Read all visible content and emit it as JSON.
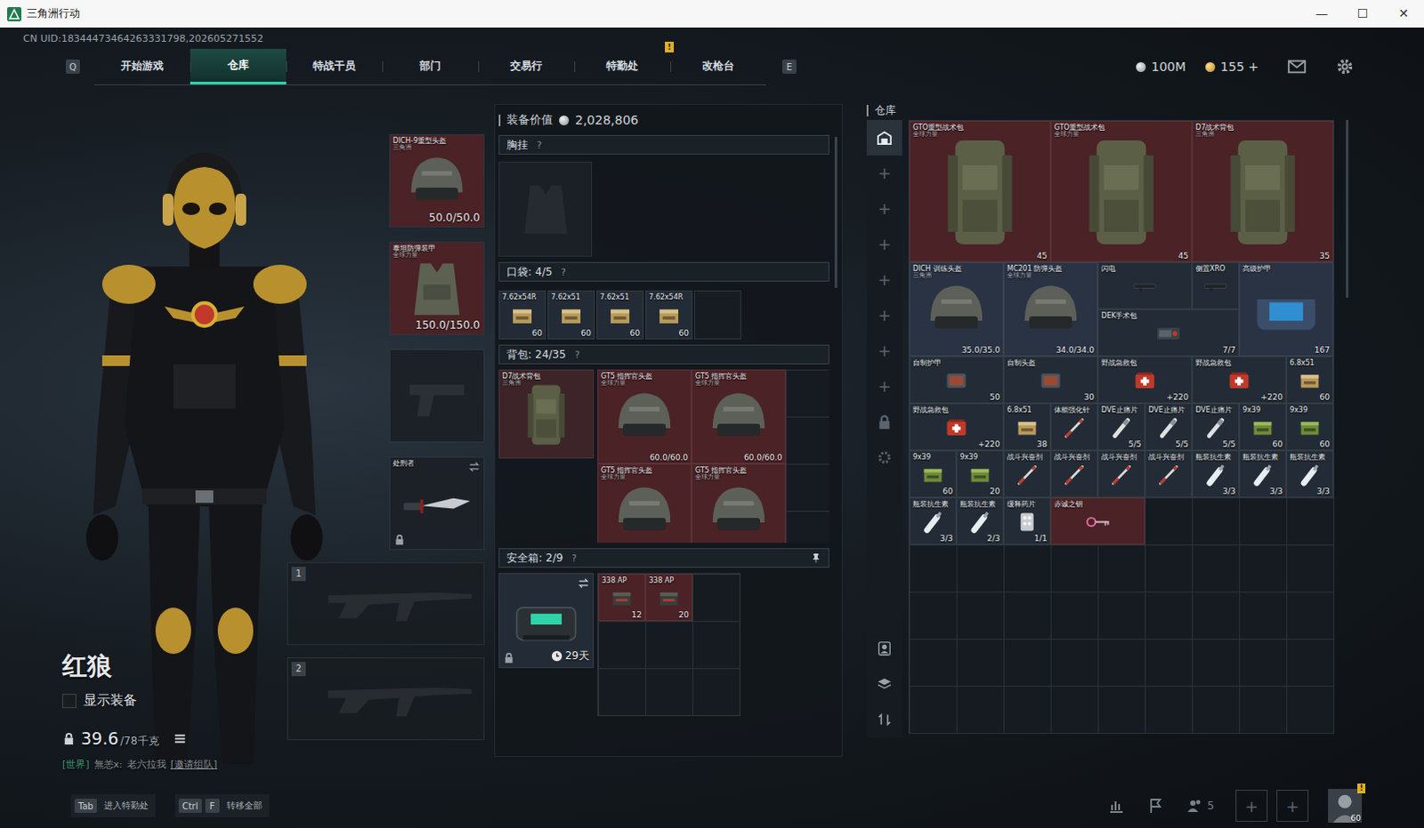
{
  "window": {
    "title": "三角洲行动",
    "controls": [
      "—",
      "☐",
      "✕"
    ]
  },
  "uid": "CN UID:18344473464263331798,202605271552",
  "nav": {
    "left_key": "Q",
    "right_key": "E",
    "tabs": [
      {
        "label": "开始游戏",
        "selected": false,
        "badge": ""
      },
      {
        "label": "仓库",
        "selected": true,
        "badge": ""
      },
      {
        "label": "特战干员",
        "selected": false,
        "badge": ""
      },
      {
        "label": "部门",
        "selected": false,
        "badge": ""
      },
      {
        "label": "交易行",
        "selected": false,
        "badge": ""
      },
      {
        "label": "特勤处",
        "selected": false,
        "badge": "!"
      },
      {
        "label": "改枪台",
        "selected": false,
        "badge": ""
      }
    ],
    "currency": [
      {
        "value": "100M",
        "kind": "silver"
      },
      {
        "value": "155 +",
        "kind": "gold"
      }
    ]
  },
  "character": {
    "name": "红狼",
    "show_gear": {
      "label": "显示装备",
      "checked": false
    },
    "weight": "39.6",
    "weight_max": "/78千克",
    "chat": {
      "channel": "[世界]",
      "user": "無恙x:",
      "message": "老六拉我",
      "action": "[邀请组队]"
    }
  },
  "equipment": [
    {
      "name": "DICH-9重型头盔",
      "sub": "三角洲",
      "value": "50.0/50.0",
      "kind": "helmet",
      "color": "#4b2226",
      "locked": false,
      "swappable": false
    },
    {
      "name": "泰坦防弹装甲",
      "sub": "全球力量",
      "value": "150.0/150.0",
      "kind": "armor",
      "color": "#4b2226",
      "locked": false,
      "swappable": false
    },
    {
      "name": "",
      "sub": "",
      "value": "",
      "kind": "pistol",
      "color": "#1b2127",
      "locked": false,
      "swappable": false
    },
    {
      "name": "处刑者",
      "sub": "",
      "value": "",
      "kind": "knife",
      "color": "#1b2127",
      "locked": true,
      "swappable": true
    }
  ],
  "weapon_slots": [
    {
      "label": "1"
    },
    {
      "label": "2"
    }
  ],
  "loadout": {
    "value_label": "装备价值",
    "value": "2,028,806",
    "chest": {
      "title": "胸挂",
      "help": "?"
    },
    "pockets": {
      "title": "口袋:",
      "count": "4/5",
      "help": "?",
      "empty_slots": 1,
      "items": [
        {
          "name": "7.62x54R",
          "value": "60",
          "kind": "ammo"
        },
        {
          "name": "7.62x51",
          "value": "60",
          "kind": "ammo"
        },
        {
          "name": "7.62x51",
          "value": "60",
          "kind": "ammo"
        },
        {
          "name": "7.62x54R",
          "value": "60",
          "kind": "ammo"
        }
      ]
    },
    "backpack": {
      "title": "背包:",
      "count": "24/35",
      "help": "?",
      "bag": {
        "name": "D7战术背包",
        "sub": "三角洲",
        "kind": "bag",
        "color": "#3d2428"
      },
      "items": [
        {
          "name": "GT5 指挥官头盔",
          "sub": "全球力量",
          "value": "60.0/60.0",
          "kind": "helmet",
          "color": "#4b2226",
          "size": [
            2,
            2
          ]
        },
        {
          "name": "GT5 指挥官头盔",
          "sub": "全球力量",
          "value": "60.0/60.0",
          "kind": "helmet",
          "color": "#4b2226",
          "size": [
            2,
            2
          ]
        },
        {
          "name": "GT5 指挥官头盔",
          "sub": "全球力量",
          "value": "",
          "kind": "helmet",
          "color": "#4b2226",
          "size": [
            2,
            2
          ]
        },
        {
          "name": "GT5 指挥官头盔",
          "sub": "全球力量",
          "value": "",
          "kind": "helmet",
          "color": "#4b2226",
          "size": [
            2,
            2
          ]
        }
      ]
    },
    "safe": {
      "title": "安全箱:",
      "count": "2/9",
      "help": "?",
      "pinned": true,
      "case": {
        "kind": "case",
        "time": "29天",
        "locked": true
      },
      "empty_slots": 7,
      "items": [
        {
          "name": "338 AP",
          "value": "12",
          "kind": "ammo-dark",
          "color": "#4b2226"
        },
        {
          "name": "338 AP",
          "value": "20",
          "kind": "ammo-dark",
          "color": "#4b2226"
        }
      ]
    }
  },
  "warehouse": {
    "title": "仓库",
    "side_tabs": [
      {
        "kind": "warehouse",
        "label": "",
        "selected": true
      },
      {
        "kind": "plus",
        "label": "+",
        "selected": false
      },
      {
        "kind": "plus",
        "label": "+",
        "selected": false
      },
      {
        "kind": "plus",
        "label": "+",
        "selected": false
      },
      {
        "kind": "plus",
        "label": "+",
        "selected": false
      },
      {
        "kind": "plus",
        "label": "+",
        "selected": false
      },
      {
        "kind": "plus",
        "label": "+",
        "selected": false
      },
      {
        "kind": "plus",
        "label": "+",
        "selected": false
      },
      {
        "kind": "lock",
        "label": "",
        "selected": false
      },
      {
        "kind": "gear",
        "label": "",
        "selected": false
      }
    ],
    "tools": [
      "person",
      "layers",
      "sort"
    ],
    "items": [
      {
        "name": "GTO重型战术包",
        "sub": "全球力量",
        "value": "45",
        "kind": "bag",
        "color": "#4b2226",
        "size": [
          3,
          3
        ]
      },
      {
        "name": "GTO重型战术包",
        "sub": "全球力量",
        "value": "45",
        "kind": "bag",
        "color": "#4b2226",
        "size": [
          3,
          3
        ]
      },
      {
        "name": "D7战术背包",
        "sub": "三角洲",
        "value": "35",
        "kind": "bag",
        "color": "#4b2226",
        "size": [
          3,
          3
        ]
      },
      {
        "name": "DICH 训练头盔",
        "sub": "三角洲",
        "value": "35.0/35.0",
        "kind": "helmet",
        "color": "#2a3344",
        "size": [
          2,
          2
        ]
      },
      {
        "name": "MC201 防弹头盔",
        "sub": "全球力量",
        "value": "34.0/34.0",
        "kind": "helmet",
        "color": "#2a3344",
        "size": [
          2,
          2
        ]
      },
      {
        "name": "闪电",
        "sub": "",
        "value": "",
        "kind": "attachment",
        "color": "#232c36",
        "size": [
          2,
          1
        ]
      },
      {
        "name": "侧置XRO",
        "sub": "",
        "value": "",
        "kind": "attachment",
        "color": "#232c36",
        "size": [
          1,
          1
        ]
      },
      {
        "name": "高级护甲",
        "sub": "",
        "value": "167",
        "kind": "rig",
        "color": "#2a3344",
        "size": [
          2,
          2
        ]
      },
      {
        "name": "DEK手术包",
        "sub": "",
        "value": "7/7",
        "kind": "surgery",
        "color": "#232c36",
        "size": [
          3,
          1
        ]
      },
      {
        "name": "自制护甲",
        "sub": "",
        "value": "50",
        "kind": "plate",
        "color": "#232c36",
        "size": [
          2,
          1
        ]
      },
      {
        "name": "自制头盔",
        "sub": "",
        "value": "30",
        "kind": "plate",
        "color": "#232c36",
        "size": [
          2,
          1
        ]
      },
      {
        "name": "野战急救包",
        "sub": "",
        "value": "+220",
        "kind": "medkit",
        "color": "#232c36",
        "size": [
          2,
          1
        ]
      },
      {
        "name": "野战急救包",
        "sub": "",
        "value": "+220",
        "kind": "medkit",
        "color": "#232c36",
        "size": [
          2,
          1
        ]
      },
      {
        "name": "6.8x51",
        "sub": "",
        "value": "60",
        "kind": "ammo",
        "color": "#232c36",
        "size": [
          1,
          1
        ]
      },
      {
        "name": "野战急救包",
        "sub": "",
        "value": "+220",
        "kind": "medkit",
        "color": "#232c36",
        "size": [
          2,
          1
        ]
      },
      {
        "name": "6.8x51",
        "sub": "",
        "value": "38",
        "kind": "ammo",
        "color": "#232c36",
        "size": [
          1,
          1
        ]
      },
      {
        "name": "体能强化针",
        "sub": "",
        "value": "",
        "kind": "injector",
        "color": "#232c36",
        "size": [
          1,
          1
        ]
      },
      {
        "name": "DVE止痛片",
        "sub": "",
        "value": "5/5",
        "kind": "painkiller",
        "color": "#232c36",
        "size": [
          1,
          1
        ]
      },
      {
        "name": "DVE止痛片",
        "sub": "",
        "value": "5/5",
        "kind": "painkiller",
        "color": "#232c36",
        "size": [
          1,
          1
        ]
      },
      {
        "name": "DVE止痛片",
        "sub": "",
        "value": "5/5",
        "kind": "painkiller",
        "color": "#232c36",
        "size": [
          1,
          1
        ]
      },
      {
        "name": "9x39",
        "sub": "",
        "value": "60",
        "kind": "ammo-green",
        "color": "#232c36",
        "size": [
          1,
          1
        ]
      },
      {
        "name": "9x39",
        "sub": "",
        "value": "60",
        "kind": "ammo-green",
        "color": "#232c36",
        "size": [
          1,
          1
        ]
      },
      {
        "name": "9x39",
        "sub": "",
        "value": "60",
        "kind": "ammo-green",
        "color": "#232c36",
        "size": [
          1,
          1
        ]
      },
      {
        "name": "9x39",
        "sub": "",
        "value": "20",
        "kind": "ammo-green",
        "color": "#232c36",
        "size": [
          1,
          1
        ]
      },
      {
        "name": "战斗兴奋剂",
        "sub": "",
        "value": "",
        "kind": "injector",
        "color": "#232c36",
        "size": [
          1,
          1
        ]
      },
      {
        "name": "战斗兴奋剂",
        "sub": "",
        "value": "",
        "kind": "injector",
        "color": "#232c36",
        "size": [
          1,
          1
        ]
      },
      {
        "name": "战斗兴奋剂",
        "sub": "",
        "value": "",
        "kind": "injector",
        "color": "#232c36",
        "size": [
          1,
          1
        ]
      },
      {
        "name": "战斗兴奋剂",
        "sub": "",
        "value": "",
        "kind": "injector",
        "color": "#232c36",
        "size": [
          1,
          1
        ]
      },
      {
        "name": "瓶装抗生素",
        "sub": "",
        "value": "3/3",
        "kind": "bottle",
        "color": "#232c36",
        "size": [
          1,
          1
        ]
      },
      {
        "name": "瓶装抗生素",
        "sub": "",
        "value": "3/3",
        "kind": "bottle",
        "color": "#232c36",
        "size": [
          1,
          1
        ]
      },
      {
        "name": "瓶装抗生素",
        "sub": "",
        "value": "3/3",
        "kind": "bottle",
        "color": "#232c36",
        "size": [
          1,
          1
        ]
      },
      {
        "name": "瓶装抗生素",
        "sub": "",
        "value": "3/3",
        "kind": "bottle",
        "color": "#232c36",
        "size": [
          1,
          1
        ]
      },
      {
        "name": "瓶装抗生素",
        "sub": "",
        "value": "2/3",
        "kind": "bottle",
        "color": "#232c36",
        "size": [
          1,
          1
        ]
      },
      {
        "name": "缓释药片",
        "sub": "",
        "value": "1/1",
        "kind": "pills",
        "color": "#232c36",
        "size": [
          1,
          1
        ]
      },
      {
        "name": "赤诚之钥",
        "sub": "",
        "value": "",
        "kind": "key",
        "color": "#4b2226",
        "size": [
          2,
          1
        ]
      }
    ]
  },
  "bottom": {
    "hints": [
      {
        "keys": [
          "Tab"
        ],
        "label": "进入特勤处"
      },
      {
        "keys": [
          "Ctrl",
          "F"
        ],
        "label": "转移全部"
      }
    ],
    "team_count": "5",
    "invite_slots": [
      "+",
      "+"
    ],
    "level": "60",
    "badge": "!"
  }
}
